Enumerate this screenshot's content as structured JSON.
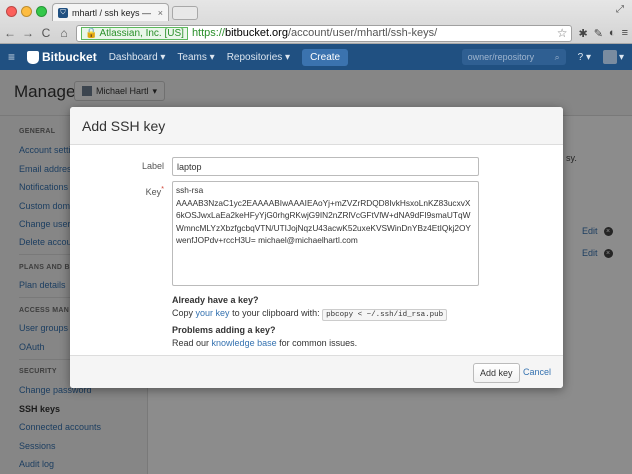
{
  "browser": {
    "tab_title": "mhartl / ssh keys — Bitbu",
    "tab_close": "×",
    "ev_label": "Atlassian, Inc. [US]",
    "url_scheme": "https://",
    "url_host": "bitbucket.org",
    "url_path": "/account/user/mhartl/ssh-keys/",
    "back": "←",
    "forward": "→",
    "reload": "C",
    "home": "⌂",
    "star": "☆",
    "menu": "≡",
    "fullscreen": "⤢"
  },
  "header": {
    "menu_icon": "≡",
    "logo": "Bitbucket",
    "nav": [
      "Dashboard ▾",
      "Teams ▾",
      "Repositories ▾"
    ],
    "create": "Create",
    "search_placeholder": "owner/repository",
    "search_icon": "⌕",
    "help": "? ▾",
    "avatar_caret": "▾"
  },
  "page": {
    "title": "Manage",
    "user_select": "Michael Hartl",
    "user_caret": "▾"
  },
  "sidebar": {
    "general_heading": "GENERAL",
    "general_items": [
      "Account setti",
      "Email addres",
      "Notifications",
      "Custom dom",
      "Change user",
      "Delete accou"
    ],
    "plans_heading": "PLANS AND B",
    "plans_items": [
      "Plan details"
    ],
    "access_heading": "ACCESS MAN",
    "access_items": [
      "User groups",
      "OAuth"
    ],
    "security_heading": "SECURITY",
    "security_items": [
      "Change password",
      "SSH keys",
      "Connected accounts",
      "Sessions",
      "Audit log"
    ]
  },
  "background": {
    "trailing_text": "sy.",
    "edit_label": "Edit",
    "delete_icon": "×"
  },
  "dialog": {
    "title": "Add SSH key",
    "label_label": "Label",
    "label_value": "laptop",
    "key_label": "Key",
    "key_required": "*",
    "key_value": "ssh-rsa\nAAAAB3NzaC1yc2EAAAABIwAAAIEAoYj+mZVZrRDQD8IvkHsxoLnKZ83ucxvX6kOSJwxLaEa2keHFyYjG0rhgRKwjG9IN2nZRlVcGFtVlW+dNA9dFI9smaUTqWWmncMLYzXbzfgcbqVTN/UTIJojNqzU43acwK52uxeKVSWinDnYBz4EtIQkj2OYwenfJOPdv+rccH3U= michael@michaelhartl.com",
    "help1_heading": "Already have a key?",
    "help1_pre": "Copy",
    "help1_link": "your key",
    "help1_mid": "to your clipboard with:",
    "help1_code": "pbcopy < ~/.ssh/id_rsa.pub",
    "help2_heading": "Problems adding a key?",
    "help2_pre": "Read our",
    "help2_link": "knowledge base",
    "help2_post": "for common issues.",
    "add_button": "Add key",
    "cancel": "Cancel"
  }
}
